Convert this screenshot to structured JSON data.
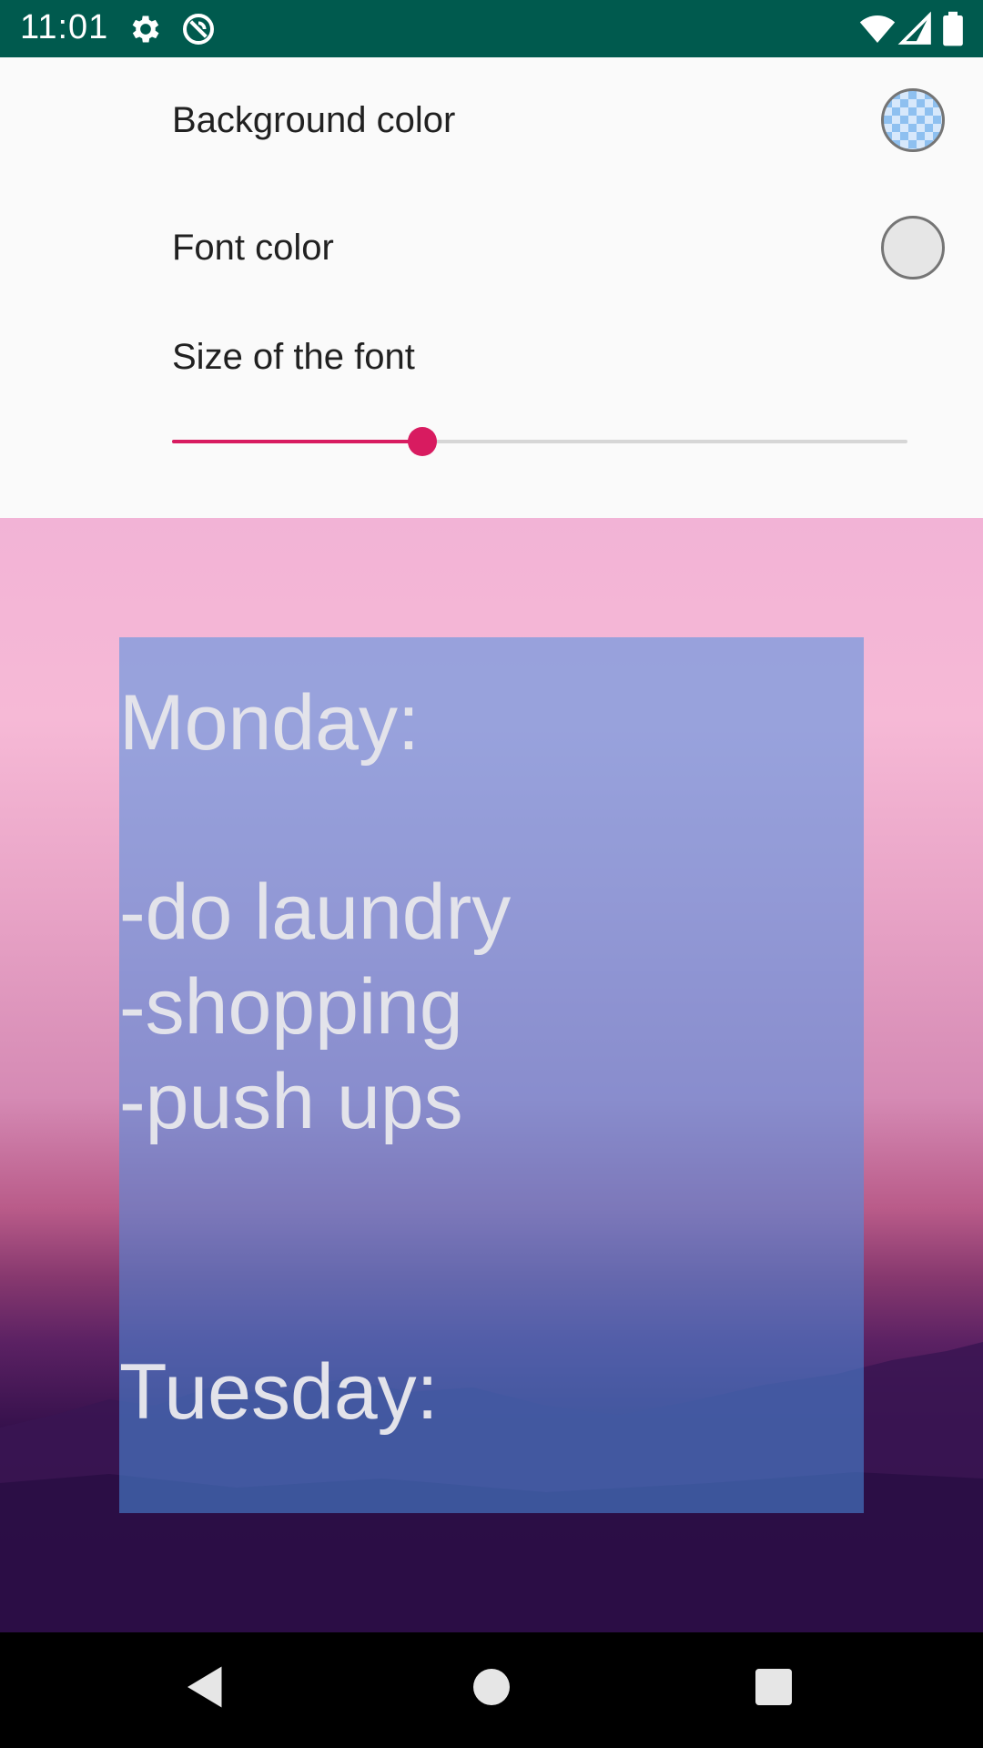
{
  "status_bar": {
    "time": "11:01",
    "background_color": "#005a4e",
    "icons": [
      "gear-icon",
      "sync-disabled-icon",
      "wifi-icon",
      "signal-icon",
      "battery-icon"
    ]
  },
  "settings": {
    "background_color": {
      "label": "Background color",
      "swatch_color": "#8ec0f0",
      "swatch_pattern": "checkerboard-transparent"
    },
    "font_color": {
      "label": "Font color",
      "swatch_color": "#e6e6e6"
    },
    "font_size": {
      "label": "Size of the font",
      "slider_fraction": 0.34,
      "accent_color": "#d81b60"
    }
  },
  "preview": {
    "widget_background": "#4a90e2",
    "text_color": "#e3e3ea",
    "lines": [
      "Monday:",
      "-do laundry",
      "-shopping",
      "-push ups",
      "Tuesday:"
    ]
  },
  "nav_bar": {
    "icons": [
      "back-icon",
      "home-icon",
      "recents-icon"
    ]
  }
}
